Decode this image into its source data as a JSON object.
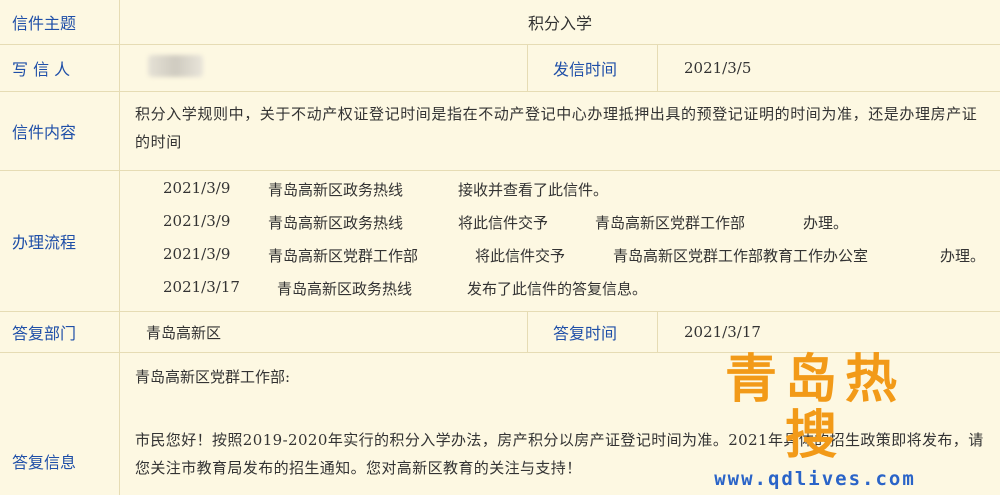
{
  "subject": {
    "label": "信件主题",
    "value": "积分入学"
  },
  "writer": {
    "label": "写 信 人",
    "time_label": "发信时间",
    "time_value": "2021/3/5"
  },
  "content": {
    "label": "信件内容",
    "text": "积分入学规则中，关于不动产权证登记时间是指在不动产登记中心办理抵押出具的预登记证明的时间为准，还是办理房产证的时间"
  },
  "process": {
    "label": "办理流程",
    "steps": [
      {
        "date": "2021/3/9",
        "dept": "青岛高新区政务热线",
        "action": "接收并查看了此信件。",
        "to": "",
        "suffix": ""
      },
      {
        "date": "2021/3/9",
        "dept": "青岛高新区政务热线",
        "action": "将此信件交予",
        "to": "青岛高新区党群工作部",
        "suffix": "办理。"
      },
      {
        "date": "2021/3/9",
        "dept": "青岛高新区党群工作部",
        "action": "将此信件交予",
        "to": "青岛高新区党群工作部教育工作办公室",
        "suffix": "办理。"
      },
      {
        "date": "2021/3/17",
        "dept": "青岛高新区政务热线",
        "action": "发布了此信件的答复信息。",
        "to": "",
        "suffix": ""
      }
    ]
  },
  "reply_dept": {
    "label": "答复部门",
    "value": "青岛高新区",
    "time_label": "答复时间",
    "time_value": "2021/3/17"
  },
  "reply": {
    "label": "答复信息",
    "greeting": "青岛高新区党群工作部:",
    "body": "市民您好！按照2019-2020年实行的积分入学办法，房产积分以房产证登记时间为准。2021年具体的招生政策即将发布，请您关注市教育局发布的招生通知。您对高新区教育的关注与支持！"
  },
  "watermark": {
    "title": "青岛热搜",
    "url": "www.qdlives.com"
  }
}
